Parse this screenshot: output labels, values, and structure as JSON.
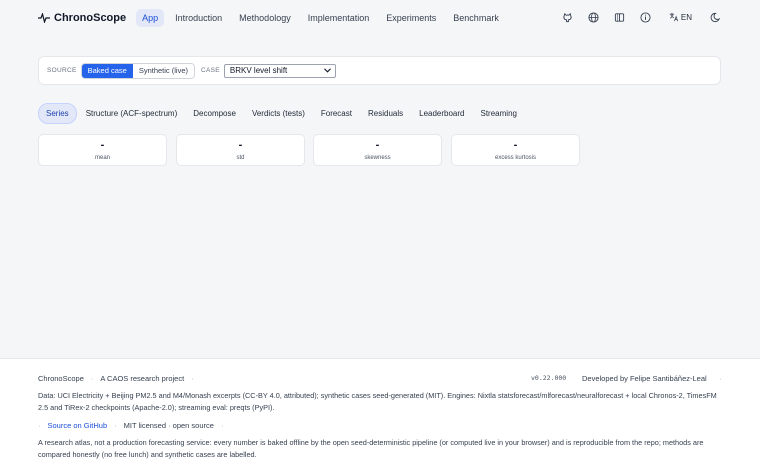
{
  "nav": {
    "brand": "ChronoScope",
    "links": [
      "App",
      "Introduction",
      "Methodology",
      "Implementation",
      "Experiments",
      "Benchmark"
    ],
    "lang": "EN"
  },
  "controls": {
    "source_label": "SOURCE",
    "source_options": [
      "Baked case",
      "Synthetic (live)"
    ],
    "case_label": "CASE",
    "case_value": "BRKV level shift"
  },
  "tabs": [
    "Series",
    "Structure (ACF-spectrum)",
    "Decompose",
    "Verdicts (tests)",
    "Forecast",
    "Residuals",
    "Leaderboard",
    "Streaming"
  ],
  "stats": [
    {
      "value": "-",
      "label": "mean"
    },
    {
      "value": "-",
      "label": "std"
    },
    {
      "value": "-",
      "label": "skewness"
    },
    {
      "value": "-",
      "label": "excess kurtosis"
    }
  ],
  "footer": {
    "brand": "ChronoScope",
    "project": "A CAOS research project",
    "version": "v0.22.000",
    "developer": "Developed by Felipe Santibáñez-Leal",
    "data": "Data: UCI Electricity + Beijing PM2.5 and M4/Monash excerpts (CC-BY 4.0, attributed); synthetic cases seed-generated (MIT). Engines: Nixtla statsforecast/mlforecast/neuralforecast + local Chronos-2, TimesFM 2.5 and TiRex-2 checkpoints (Apache-2.0); streaming eval: preqts (PyPI).",
    "github": "Source on GitHub",
    "license": "MIT licensed · open source",
    "note": "A research atlas, not a production forecasting service: every number is baked offline by the open seed-deterministic pipeline (or computed live in your browser) and is reproducible from the repo; methods are compared honestly (no free lunch) and synthetic cases are labelled."
  }
}
